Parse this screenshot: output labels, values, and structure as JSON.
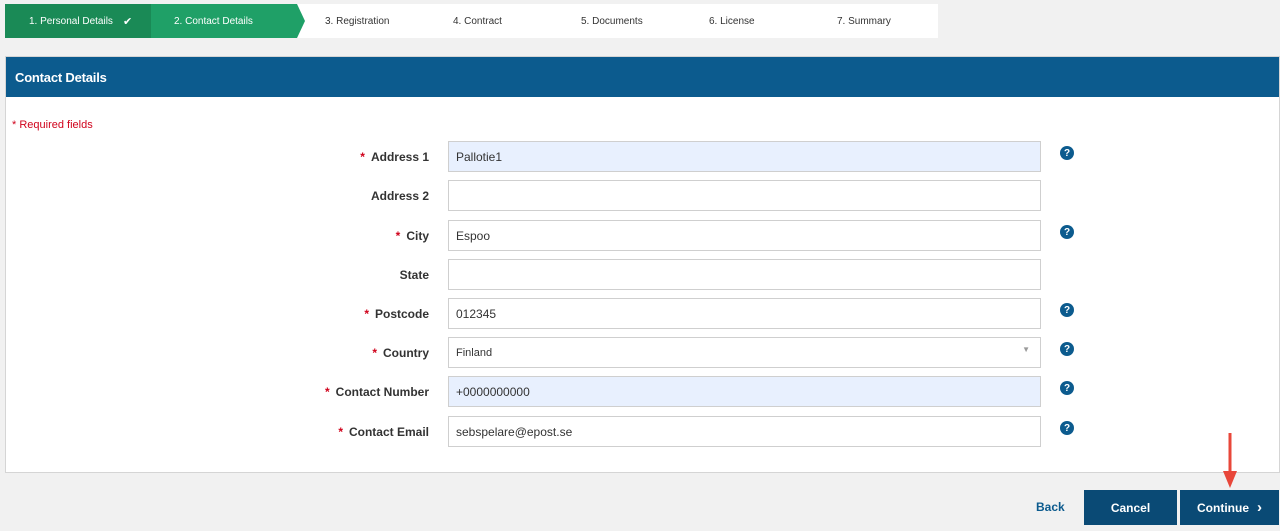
{
  "stepper": [
    {
      "label": "1. Personal Details",
      "state": "done"
    },
    {
      "label": "2. Contact Details",
      "state": "active"
    },
    {
      "label": "3. Registration",
      "state": "plain"
    },
    {
      "label": "4. Contract",
      "state": "plain"
    },
    {
      "label": "5. Documents",
      "state": "plain"
    },
    {
      "label": "6. License",
      "state": "plain"
    },
    {
      "label": "7. Summary",
      "state": "plain"
    }
  ],
  "check_glyph": "✔",
  "panel": {
    "title": "Contact Details",
    "required_note": "* Required fields"
  },
  "form": {
    "address1": {
      "label": "Address 1",
      "value": "Pallotie1"
    },
    "address2": {
      "label": "Address 2",
      "value": ""
    },
    "city": {
      "label": "City",
      "value": "Espoo"
    },
    "state": {
      "label": "State",
      "value": ""
    },
    "postcode": {
      "label": "Postcode",
      "value": "012345"
    },
    "country": {
      "label": "Country",
      "value": "Finland"
    },
    "contact_number": {
      "label": "Contact Number",
      "value": "+0000000000"
    },
    "contact_email": {
      "label": "Contact Email",
      "value": "sebspelare@epost.se"
    }
  },
  "required_star": "*",
  "help_glyph": "?",
  "footer": {
    "back": "Back",
    "cancel": "Cancel",
    "continue": "Continue",
    "continue_glyph": "›"
  },
  "colors": {
    "header_blue": "#0c5b8e",
    "step_done": "#1a8a56",
    "step_active": "#1fa067",
    "required_red": "#d0021b",
    "button_blue": "#0a4a75",
    "annotation_arrow": "#e8473a"
  }
}
